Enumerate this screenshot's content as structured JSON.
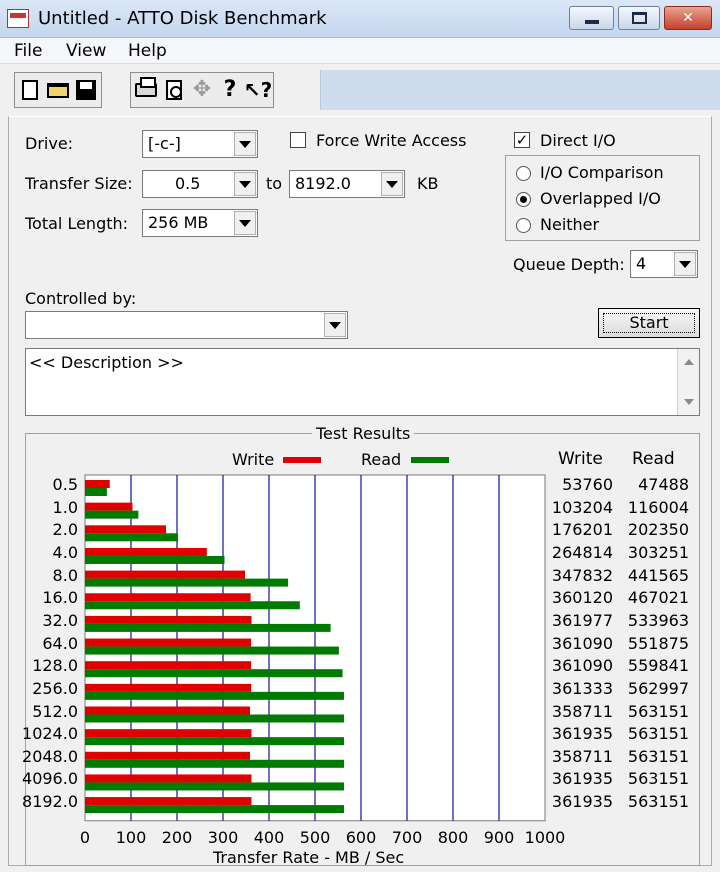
{
  "window": {
    "title": "Untitled - ATTO Disk Benchmark"
  },
  "menu": [
    "File",
    "View",
    "Help"
  ],
  "toolbar": {
    "icons": [
      "new-icon",
      "open-icon",
      "save-icon",
      "print-icon",
      "print-preview-icon",
      "move-icon",
      "help-icon",
      "context-help-icon"
    ]
  },
  "form": {
    "drive_label": "Drive:",
    "drive_value": "[-c-]",
    "force_write_label": "Force Write Access",
    "force_write_checked": false,
    "direct_io_label": "Direct I/O",
    "direct_io_checked": true,
    "transfer_size_label": "Transfer Size:",
    "transfer_size_from": "0.5",
    "to_label": "to",
    "transfer_size_to": "8192.0",
    "kb_label": "KB",
    "total_length_label": "Total Length:",
    "total_length_value": "256 MB",
    "io_mode_options": [
      "I/O Comparison",
      "Overlapped I/O",
      "Neither"
    ],
    "io_mode_selected": "Overlapped I/O",
    "queue_depth_label": "Queue Depth:",
    "queue_depth_value": "4",
    "controlled_by_label": "Controlled by:",
    "controlled_by_value": "",
    "start_label": "Start",
    "description": "<< Description >>"
  },
  "results": {
    "title": "Test Results",
    "legend_write": "Write",
    "legend_read": "Read",
    "col_write": "Write",
    "col_read": "Read"
  },
  "chart_data": {
    "type": "bar",
    "orientation": "horizontal",
    "xlabel": "Transfer Rate - MB / Sec",
    "xlim": [
      0,
      1000
    ],
    "xticks": [
      "0",
      "100",
      "200",
      "300",
      "400",
      "500",
      "600",
      "700",
      "800",
      "900",
      "1000"
    ],
    "categories": [
      "0.5",
      "1.0",
      "2.0",
      "4.0",
      "8.0",
      "16.0",
      "32.0",
      "64.0",
      "128.0",
      "256.0",
      "512.0",
      "1024.0",
      "2048.0",
      "4096.0",
      "8192.0"
    ],
    "series": [
      {
        "name": "Write",
        "color": "#e00000",
        "values": [
          53760,
          103204,
          176201,
          264814,
          347832,
          360120,
          361977,
          361090,
          361090,
          361333,
          358711,
          361935,
          358711,
          361935,
          361935
        ]
      },
      {
        "name": "Read",
        "color": "#007a00",
        "values": [
          47488,
          116004,
          202350,
          303251,
          441565,
          467021,
          533963,
          551875,
          559841,
          562997,
          563151,
          563151,
          563151,
          563151,
          563151
        ]
      }
    ],
    "grid": true,
    "legend": "top"
  }
}
